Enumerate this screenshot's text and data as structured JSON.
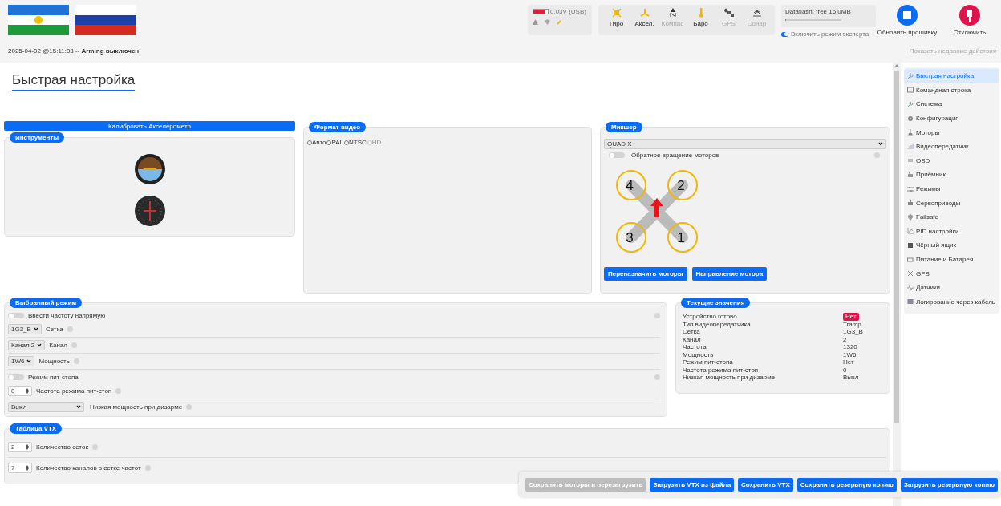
{
  "flags": [
    {
      "kind": "bashkortostan"
    },
    {
      "kind": "russia"
    }
  ],
  "battery": {
    "reading": "0.03V (USB)",
    "level": 0.85
  },
  "sensors": [
    {
      "label": "Гиро",
      "kind": "gyro",
      "active": true
    },
    {
      "label": "Аксел.",
      "kind": "accel",
      "active": true
    },
    {
      "label": "Компас",
      "kind": "compass",
      "active": false
    },
    {
      "label": "Баро",
      "kind": "baro",
      "active": true
    },
    {
      "label": "GPS",
      "kind": "gps",
      "active": false
    },
    {
      "label": "Сонар",
      "kind": "sonar",
      "active": false
    }
  ],
  "dataflash": {
    "label": "Dataflash: free 16.0MB",
    "level": 0.02
  },
  "expert_mode": {
    "label": "Включить режим эксперта",
    "on": true
  },
  "header_buttons": [
    {
      "label": "Обновить прошивку",
      "kind": "flash"
    },
    {
      "label": "Отключить",
      "kind": "disconnect"
    }
  ],
  "recent_actions": "Показать недавние действия",
  "status": "2025-04-02 @15:11:03 -- **Arming выключен**",
  "page_title": "Быстрая настройка",
  "calibrate_button": "Калибровать Акселерометр",
  "instruments": {
    "title": "Инструменты"
  },
  "video_format": {
    "title": "Формат видео",
    "options": [
      {
        "label": "Авто",
        "selected": false,
        "disabled": false
      },
      {
        "label": "PAL",
        "selected": false,
        "disabled": false
      },
      {
        "label": "NTSC",
        "selected": false,
        "disabled": false
      },
      {
        "label": "HD",
        "selected": false,
        "disabled": true
      }
    ]
  },
  "mixer": {
    "title": "Микшер",
    "select": "QUAD X",
    "reverse": {
      "label": "Обратное вращение моторов",
      "on": false
    },
    "motors": [
      "4",
      "2",
      "3",
      "1"
    ],
    "buttons": [
      "Переназначить моторы",
      "Направление мотора"
    ]
  },
  "mode": {
    "title": "Выбранный режим",
    "groups": [
      [
        {
          "kind": "toggle",
          "label": "Ввести частоту напрямую",
          "on": false
        },
        {
          "kind": "select",
          "value": "1G3_B",
          "label": "Сетка"
        }
      ],
      [
        {
          "kind": "select",
          "value": "Канал 2",
          "label": "Канал"
        }
      ],
      [
        {
          "kind": "select",
          "value": "1W6",
          "label": "Мощность"
        }
      ],
      [
        {
          "kind": "toggle",
          "label": "Режим пит-стопа",
          "on": false
        },
        {
          "kind": "number",
          "value": "0",
          "label": "Частота режима пит-стоп"
        }
      ],
      [
        {
          "kind": "wide_select",
          "value": "Выкл",
          "label": "Низкая мощность при дизарме"
        }
      ]
    ]
  },
  "current": {
    "title": "Текущие значения",
    "rows": [
      {
        "label": "Устройство готово",
        "value": "Нет",
        "kind": "badge"
      },
      {
        "label": "Тип видеопередатчика",
        "value": "Tramp",
        "kind": "text"
      },
      {
        "label": "Сетка",
        "value": "1G3_B",
        "kind": "text"
      },
      {
        "label": "Канал",
        "value": "2",
        "kind": "text"
      },
      {
        "label": "Частота",
        "value": "1320",
        "kind": "text"
      },
      {
        "label": "Мощность",
        "value": "1W6",
        "kind": "text"
      },
      {
        "label": "Режим пит-стопа",
        "value": "Нет",
        "kind": "text"
      },
      {
        "label": "Частота режима пит-стоп",
        "value": "0",
        "kind": "text"
      },
      {
        "label": "Низкая мощность при дизарме",
        "value": "Выкл",
        "kind": "text"
      }
    ]
  },
  "vtx_table": {
    "title": "Таблица VTX",
    "rows": [
      {
        "value": "2",
        "label": "Количество сеток"
      },
      {
        "value": "7",
        "label": "Количество каналов в сетке частот"
      }
    ]
  },
  "sidebar": [
    {
      "label": "Быстрая настройка",
      "kind": "wrench",
      "selected": true
    },
    {
      "label": "Командная строка",
      "kind": "terminal",
      "selected": false
    },
    {
      "label": "Система",
      "kind": "wrench",
      "selected": false
    },
    {
      "label": "Конфигурация",
      "kind": "gear",
      "selected": false
    },
    {
      "label": "Моторы",
      "kind": "motor",
      "selected": false
    },
    {
      "label": "Видеопередатчик",
      "kind": "signal",
      "selected": false
    },
    {
      "label": "OSD",
      "kind": "lines",
      "selected": false
    },
    {
      "label": "Приёмник",
      "kind": "radio",
      "selected": false
    },
    {
      "label": "Режимы",
      "kind": "sliders",
      "selected": false
    },
    {
      "label": "Сервоприводы",
      "kind": "servo",
      "selected": false
    },
    {
      "label": "Failsafe",
      "kind": "shield",
      "selected": false
    },
    {
      "label": "PID настройки",
      "kind": "chart",
      "selected": false
    },
    {
      "label": "Чёрный ящик",
      "kind": "box",
      "selected": false
    },
    {
      "label": "Питание и Батарея",
      "kind": "battery",
      "selected": false
    },
    {
      "label": "GPS",
      "kind": "satellite",
      "selected": false
    },
    {
      "label": "Датчики",
      "kind": "pulse",
      "selected": false
    },
    {
      "label": "Логирование через кабель",
      "kind": "log",
      "selected": false
    }
  ],
  "actions": [
    {
      "label": "Сохранить моторы и перезагрузить",
      "disabled": true
    },
    {
      "label": "Загрузить VTX из файла",
      "disabled": false
    },
    {
      "label": "Сохранить VTX",
      "disabled": false
    },
    {
      "label": "Сохранить резервную копию",
      "disabled": false
    },
    {
      "label": "Загрузить резервную копию",
      "disabled": false
    }
  ]
}
